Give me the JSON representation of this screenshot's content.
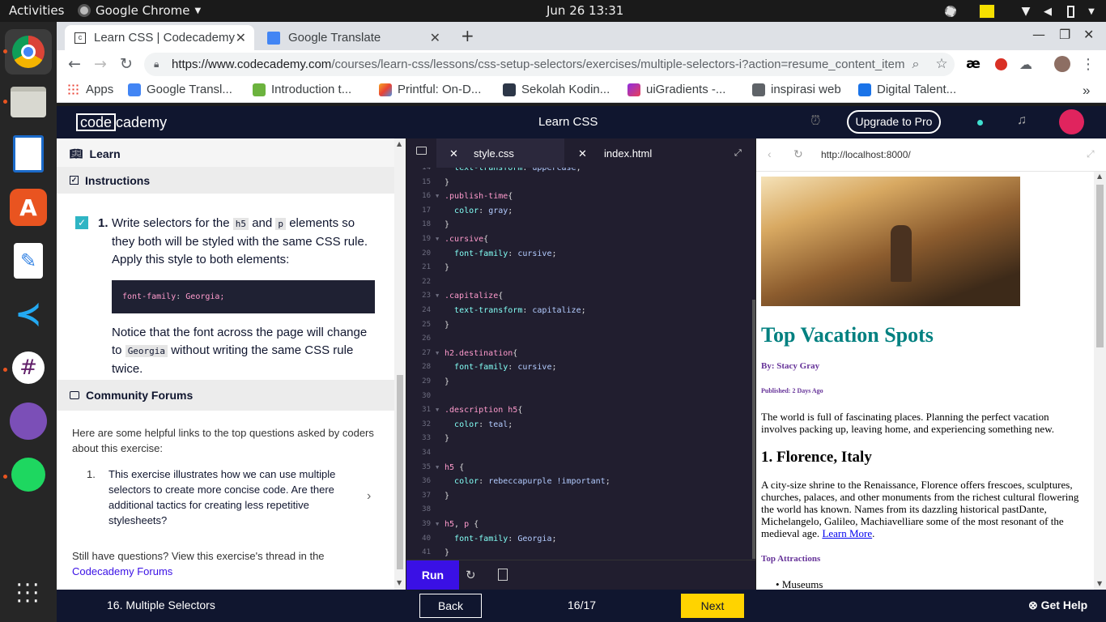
{
  "system": {
    "activities": "Activities",
    "app_name": "Google Chrome",
    "clock": "Jun 26  13:31"
  },
  "chrome": {
    "tabs": [
      {
        "title": "Learn CSS | Codecademy",
        "active": true
      },
      {
        "title": "Google Translate",
        "active": false
      }
    ],
    "url_host": "https://www.codecademy.com",
    "url_path": "/courses/learn-css/lessons/css-setup-selectors/exercises/multiple-selectors-i?action=resume_content_item",
    "bookmarks": [
      "Apps",
      "Google Transl...",
      "Introduction t...",
      "Printful: On-D...",
      "Sekolah Kodin...",
      "uiGradients -...",
      "inspirasi web",
      "Digital Talent..."
    ],
    "overflow": "»"
  },
  "header": {
    "logo_code": "code",
    "logo_rest": "cademy",
    "title": "Learn CSS",
    "upgrade": "Upgrade to Pro"
  },
  "left": {
    "learn": "Learn",
    "instructions": "Instructions",
    "step_number": "1.",
    "step_text_1": "Write selectors for the",
    "step_code_h5": "h5",
    "step_text_and": "and",
    "step_code_p": "p",
    "step_text_2": "elements so they both will be styled with the same CSS rule. Apply this style to both elements:",
    "code_prop": "font-family",
    "code_val": "Georgia;",
    "notice_1": "Notice that the font across the page will change to",
    "notice_code": "Georgia",
    "notice_2": "without writing the same CSS rule twice.",
    "forums_title": "Community Forums",
    "forums_intro": "Here are some helpful links to the top questions asked by coders about this exercise:",
    "forum_item_num": "1.",
    "forum_item": "This exercise illustrates how we can use multiple selectors to create more concise code. Are there additional tactics for creating less repetitive stylesheets?",
    "still_q": "Still have questions? View this exercise's thread in the",
    "forums_link": "Codecademy Forums"
  },
  "editor": {
    "tab_active": "style.css",
    "tab_other": "index.html",
    "run": "Run",
    "lines": [
      {
        "n": "14",
        "fold": "",
        "parts": [
          [
            "  ",
            ""
          ],
          [
            "text-transform",
            "prop"
          ],
          [
            ": ",
            ""
          ],
          [
            "uppercase",
            "val"
          ],
          [
            ";",
            ""
          ]
        ]
      },
      {
        "n": "15",
        "fold": "",
        "parts": [
          [
            "}",
            ""
          ]
        ]
      },
      {
        "n": "16",
        "fold": "▼",
        "parts": [
          [
            ".publish-time",
            "sel"
          ],
          [
            "{",
            ""
          ]
        ]
      },
      {
        "n": "17",
        "fold": "",
        "parts": [
          [
            "  ",
            ""
          ],
          [
            "color",
            "prop"
          ],
          [
            ": ",
            ""
          ],
          [
            "gray",
            "val"
          ],
          [
            ";",
            ""
          ]
        ]
      },
      {
        "n": "18",
        "fold": "",
        "parts": [
          [
            "}",
            ""
          ]
        ]
      },
      {
        "n": "19",
        "fold": "▼",
        "parts": [
          [
            ".cursive",
            "sel"
          ],
          [
            "{",
            ""
          ]
        ]
      },
      {
        "n": "20",
        "fold": "",
        "parts": [
          [
            "  ",
            ""
          ],
          [
            "font-family",
            "prop"
          ],
          [
            ": ",
            ""
          ],
          [
            "cursive",
            "val"
          ],
          [
            ";",
            ""
          ]
        ]
      },
      {
        "n": "21",
        "fold": "",
        "parts": [
          [
            "}",
            ""
          ]
        ]
      },
      {
        "n": "22",
        "fold": "",
        "parts": []
      },
      {
        "n": "23",
        "fold": "▼",
        "parts": [
          [
            ".capitalize",
            "sel"
          ],
          [
            "{",
            ""
          ]
        ]
      },
      {
        "n": "24",
        "fold": "",
        "parts": [
          [
            "  ",
            ""
          ],
          [
            "text-transform",
            "prop"
          ],
          [
            ": ",
            ""
          ],
          [
            "capitalize",
            "val"
          ],
          [
            ";",
            ""
          ]
        ]
      },
      {
        "n": "25",
        "fold": "",
        "parts": [
          [
            "}",
            ""
          ]
        ]
      },
      {
        "n": "26",
        "fold": "",
        "parts": []
      },
      {
        "n": "27",
        "fold": "▼",
        "parts": [
          [
            "h2.destination",
            "sel"
          ],
          [
            "{",
            ""
          ]
        ]
      },
      {
        "n": "28",
        "fold": "",
        "parts": [
          [
            "  ",
            ""
          ],
          [
            "font-family",
            "prop"
          ],
          [
            ": ",
            ""
          ],
          [
            "cursive",
            "val"
          ],
          [
            ";",
            ""
          ]
        ]
      },
      {
        "n": "29",
        "fold": "",
        "parts": [
          [
            "}",
            ""
          ]
        ]
      },
      {
        "n": "30",
        "fold": "",
        "parts": []
      },
      {
        "n": "31",
        "fold": "▼",
        "parts": [
          [
            ".description h5",
            "sel"
          ],
          [
            "{",
            ""
          ]
        ]
      },
      {
        "n": "32",
        "fold": "",
        "parts": [
          [
            "  ",
            ""
          ],
          [
            "color",
            "prop"
          ],
          [
            ": ",
            ""
          ],
          [
            "teal",
            "val"
          ],
          [
            ";",
            ""
          ]
        ]
      },
      {
        "n": "33",
        "fold": "",
        "parts": [
          [
            "}",
            ""
          ]
        ]
      },
      {
        "n": "34",
        "fold": "",
        "parts": []
      },
      {
        "n": "35",
        "fold": "▼",
        "parts": [
          [
            "h5",
            "sel"
          ],
          [
            " {",
            ""
          ]
        ]
      },
      {
        "n": "36",
        "fold": "",
        "parts": [
          [
            "  ",
            ""
          ],
          [
            "color",
            "prop"
          ],
          [
            ": ",
            ""
          ],
          [
            "rebeccapurple !important",
            "val"
          ],
          [
            ";",
            ""
          ]
        ]
      },
      {
        "n": "37",
        "fold": "",
        "parts": [
          [
            "}",
            ""
          ]
        ]
      },
      {
        "n": "38",
        "fold": "",
        "parts": []
      },
      {
        "n": "39",
        "fold": "▼",
        "parts": [
          [
            "h5",
            "sel"
          ],
          [
            ", ",
            ""
          ],
          [
            "p",
            "sel"
          ],
          [
            " {",
            ""
          ]
        ]
      },
      {
        "n": "40",
        "fold": "",
        "parts": [
          [
            "  ",
            ""
          ],
          [
            "font-family",
            "prop"
          ],
          [
            ": ",
            ""
          ],
          [
            "Georgia",
            "val"
          ],
          [
            ";",
            ""
          ]
        ]
      },
      {
        "n": "41",
        "fold": "",
        "parts": [
          [
            "}",
            ""
          ]
        ]
      }
    ]
  },
  "preview": {
    "url": "http://localhost:8000/",
    "title": "Top Vacation Spots",
    "byline": "By: Stacy Gray",
    "published": "Published: 2 Days Ago",
    "intro": "The world is full of fascinating places. Planning the perfect vacation involves packing up, leaving home, and experiencing something new.",
    "h2": "1. Florence, Italy",
    "body": "A city-size shrine to the Renaissance, Florence offers frescoes, sculptures, churches, palaces, and other monuments from the richest cultural flowering the world has known. Names from its dazzling historical pastDante, Michelangelo, Galileo, Machiavelliare some of the most resonant of the medieval age.",
    "learn_more": "Learn More",
    "attractions": "Top Attractions",
    "list_item": "Museums"
  },
  "footer": {
    "exercise": "16. Multiple Selectors",
    "back": "Back",
    "progress": "16/17",
    "next": "Next",
    "help": "Get Help"
  },
  "colors": {
    "cc_navy": "#10162f",
    "run_purple": "#3a10e5",
    "next_yellow": "#ffd300",
    "teal_heading": "#008080",
    "rebeccapurple": "#663399"
  }
}
